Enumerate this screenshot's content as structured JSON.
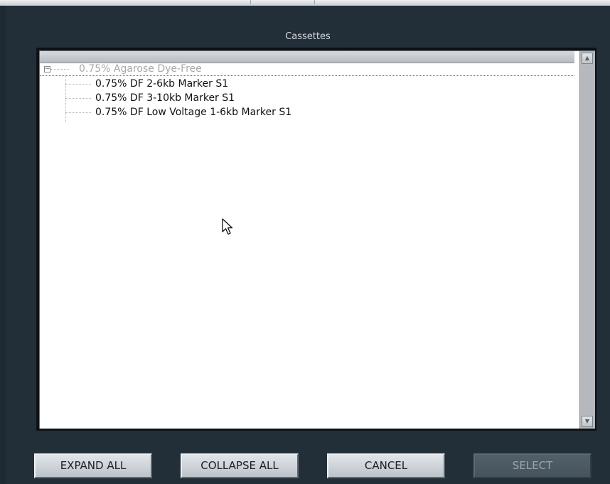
{
  "dialog": {
    "title": "Cassettes"
  },
  "tree": {
    "root": {
      "label": "0.75% Agarose Dye-Free",
      "expanded": true,
      "expander_symbol": "−"
    },
    "children": [
      {
        "label": "0.75% DF 2-6kb Marker S1"
      },
      {
        "label": "0.75% DF 3-10kb Marker S1"
      },
      {
        "label": "0.75% DF Low Voltage 1-6kb Marker S1"
      }
    ]
  },
  "scrollbar": {
    "up_icon": "▲",
    "down_icon": "▼"
  },
  "buttons": {
    "expand_all": "EXPAND ALL",
    "collapse_all": "COLLAPSE ALL",
    "cancel": "CANCEL",
    "select": "SELECT",
    "select_enabled": false
  },
  "colors": {
    "background": "#232f38",
    "list_background": "#ffffff",
    "disabled_text": "#a8a8a8"
  }
}
